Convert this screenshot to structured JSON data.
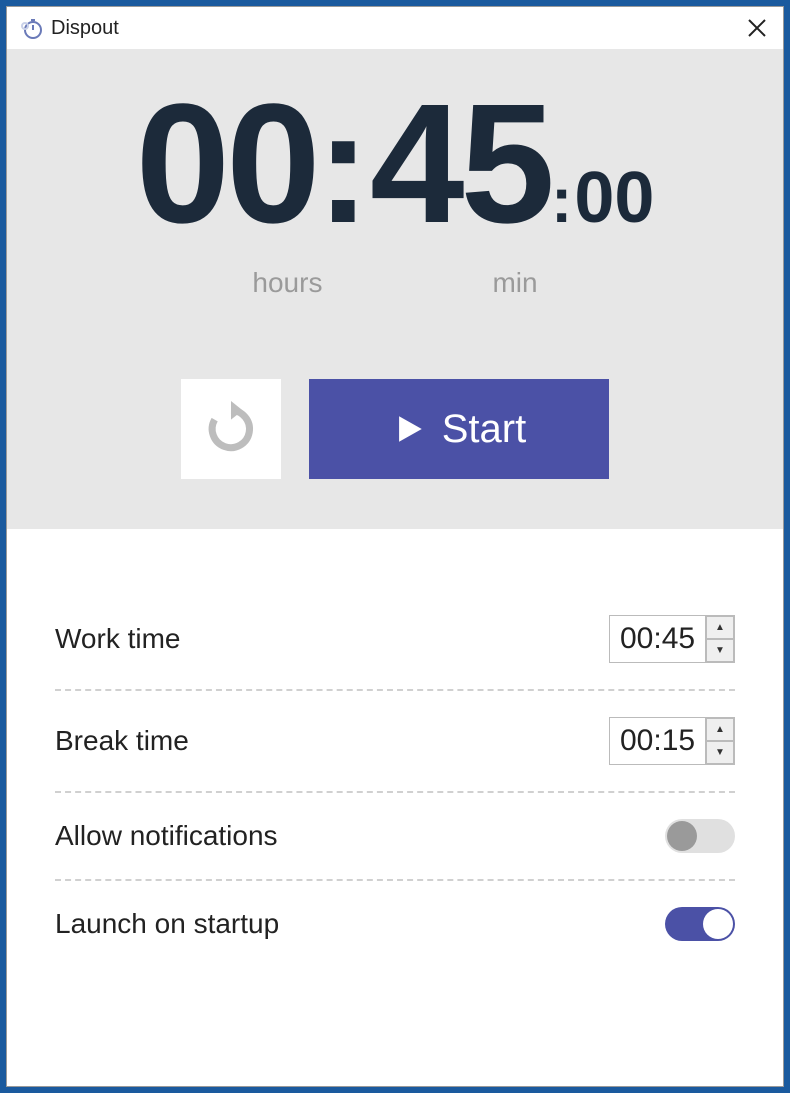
{
  "app": {
    "title": "Dispout"
  },
  "timer": {
    "hours": "00",
    "minutes": "45",
    "seconds": "00",
    "label_hours": "hours",
    "label_min": "min"
  },
  "controls": {
    "start_label": "Start"
  },
  "settings": {
    "work_time": {
      "label": "Work time",
      "value": "00:45"
    },
    "break_time": {
      "label": "Break time",
      "value": "00:15"
    },
    "notifications": {
      "label": "Allow notifications",
      "on": false
    },
    "startup": {
      "label": "Launch on startup",
      "on": true
    }
  },
  "colors": {
    "accent": "#4b51a6"
  }
}
